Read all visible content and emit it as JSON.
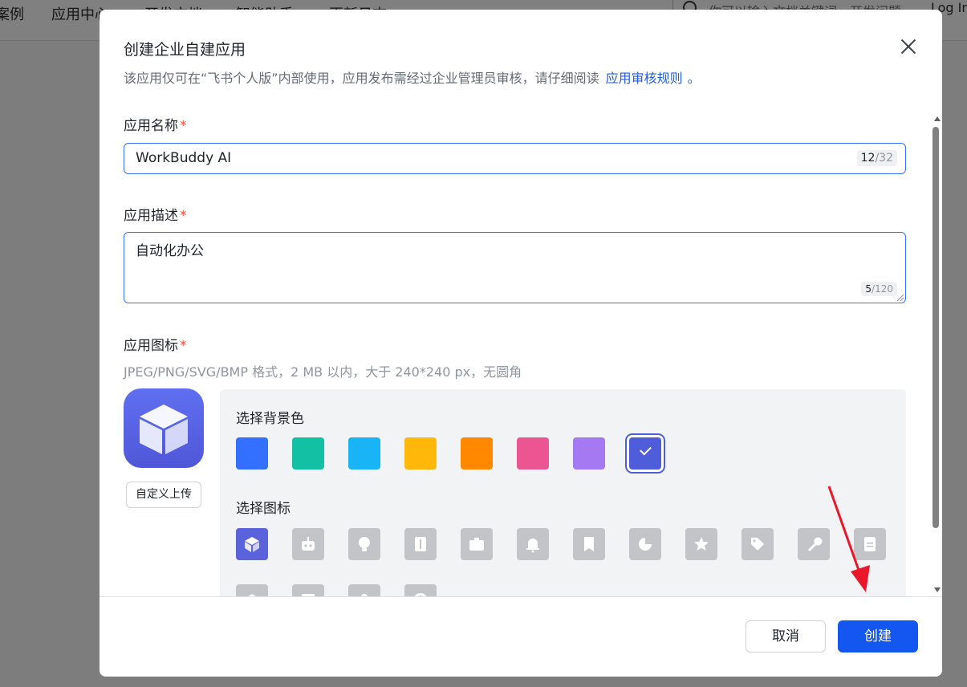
{
  "background": {
    "nav_items": [
      "案例",
      "应用中心",
      "开发文档",
      "智能助手",
      "更新日志"
    ],
    "search_placeholder": "你可以输入文档关键词，开发问题",
    "login_label": "Log In"
  },
  "modal": {
    "title": "创建企业自建应用",
    "subtitle": "该应用仅可在“飞书个人版”内部使用，应用发布需经过企业管理员审核，请仔细阅读",
    "subtitle_link": "应用审核规则",
    "subtitle_end": "。",
    "name_field": {
      "label": "应用名称",
      "required_mark": "*",
      "value": "WorkBuddy AI",
      "count": "12",
      "max": "/32"
    },
    "desc_field": {
      "label": "应用描述",
      "required_mark": "*",
      "value": "自动化办公",
      "count": "5",
      "max": "/120"
    },
    "icon_field": {
      "label": "应用图标",
      "required_mark": "*",
      "hint": "JPEG/PNG/SVG/BMP 格式，2 MB 以内，大于 240*240 px，无圆角",
      "upload_label": "自定义上传",
      "bg_color_label": "选择背景色",
      "bg_colors": [
        "#3370ff",
        "#14c0a4",
        "#18b4f5",
        "#ffb80a",
        "#ff8800",
        "#eb5591",
        "#a479f2",
        "#4f5ddb"
      ],
      "selected_color_index": 7,
      "icon_label": "选择图标",
      "icons": [
        "cube-icon",
        "robot-icon",
        "bulb-icon",
        "book-icon",
        "briefcase-icon",
        "bell-icon",
        "bookmark-icon",
        "pie-icon",
        "star-icon",
        "tag-icon",
        "wrench-icon",
        "document-icon",
        "gem-icon",
        "board-icon",
        "person-icon",
        "clock-icon"
      ],
      "selected_icon_index": 0
    },
    "footer": {
      "cancel_label": "取消",
      "create_label": "创建"
    }
  }
}
